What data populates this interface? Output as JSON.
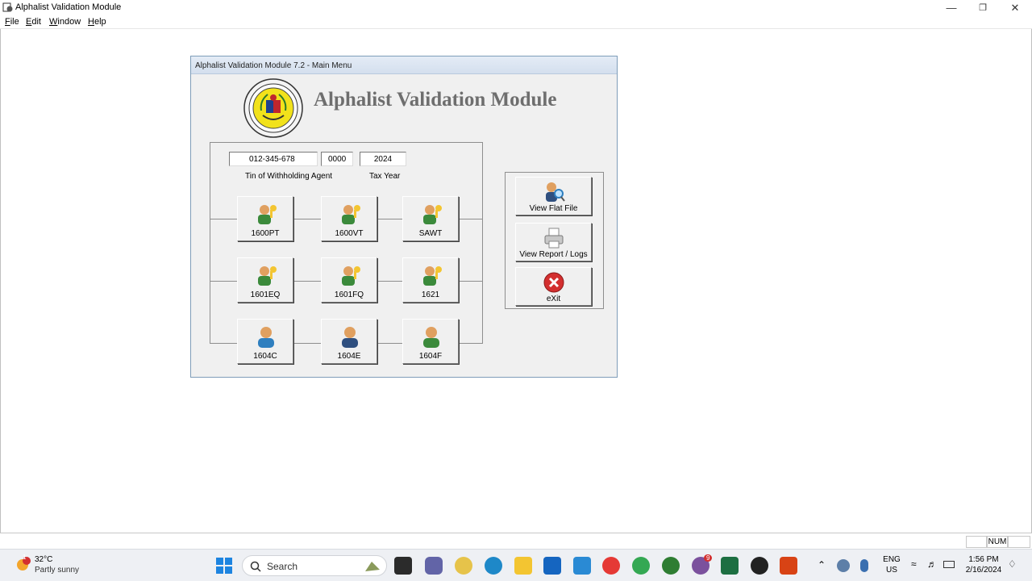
{
  "app": {
    "title": "Alphalist Validation Module"
  },
  "menu": {
    "items": [
      {
        "label": "File",
        "mnemonic": "F",
        "rest": "ile"
      },
      {
        "label": "Edit",
        "mnemonic": "E",
        "rest": "dit"
      },
      {
        "label": "Window",
        "mnemonic": "W",
        "rest": "indow"
      },
      {
        "label": "Help",
        "mnemonic": "H",
        "rest": "elp"
      }
    ]
  },
  "main_menu": {
    "window_title": "Alphalist Validation Module 7.2 - Main Menu",
    "heading": "Alphalist Validation Module",
    "tin_value": "012-345-678",
    "branch_code": "0000",
    "tax_year": "2024",
    "tin_label": "Tin of Withholding Agent",
    "year_label": "Tax Year",
    "forms": [
      {
        "label": "1600PT"
      },
      {
        "label": "1600VT"
      },
      {
        "label": "SAWT"
      },
      {
        "label": "1601EQ"
      },
      {
        "label": "1601FQ"
      },
      {
        "label": "1621"
      },
      {
        "label": "1604C"
      },
      {
        "label": "1604E"
      },
      {
        "label": "1604F"
      }
    ],
    "side_buttons": {
      "view_flat_file": "View Flat File",
      "view_report_logs": "View Report / Logs",
      "exit": "eXit"
    }
  },
  "statusbar": {
    "num": "NUM"
  },
  "taskbar": {
    "weather_temp": "32°C",
    "weather_desc": "Partly sunny",
    "weather_badge": "1",
    "search_label": "Search",
    "lang_top": "ENG",
    "lang_bottom": "US",
    "time": "1:56 PM",
    "date": "2/16/2024",
    "viber_badge": "9"
  },
  "colors": {
    "heading_gray": "#6e6e6e",
    "exit_red": "#d32f2f",
    "excel_green": "#1d6f42"
  }
}
